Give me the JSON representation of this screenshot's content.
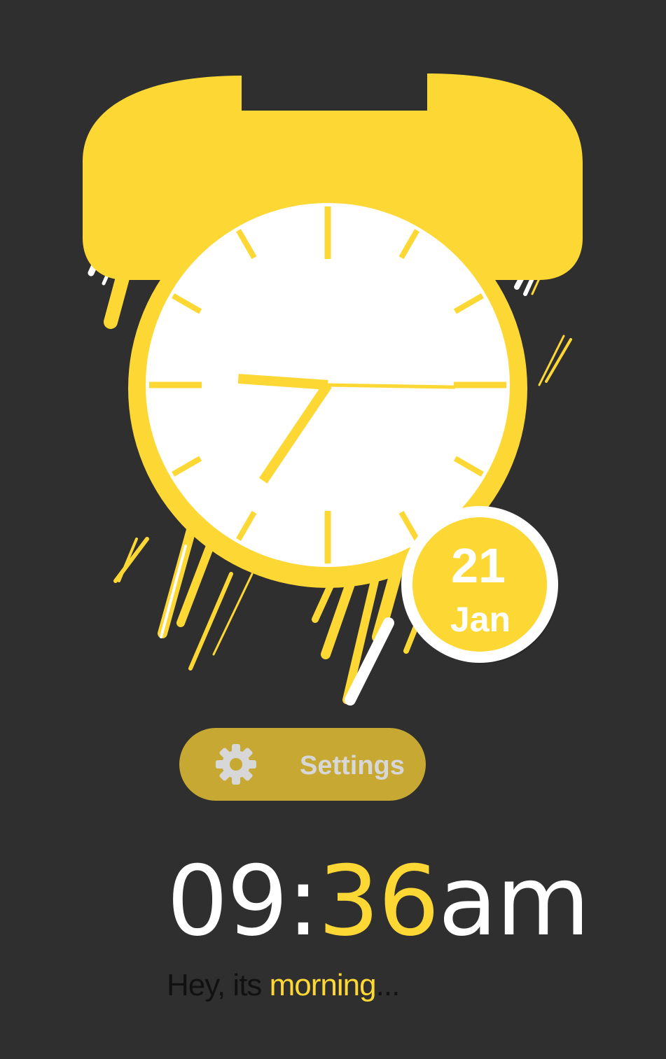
{
  "colors": {
    "background": "#2f2f2f",
    "accent": "#fdd835",
    "clock_face": "#ffffff",
    "button_fill": "#c6a832",
    "button_text": "#d7d7d7",
    "greeting_text": "#111111"
  },
  "clock": {
    "hour_hand_value": 9.6,
    "minute_hand_value": 36,
    "second_hand_value": 15
  },
  "date_badge": {
    "day": "21",
    "month": "Jan"
  },
  "settings": {
    "icon": "gear-icon",
    "label": "Settings"
  },
  "time": {
    "hours": "09",
    "separator": ":",
    "minutes": "36",
    "suffix": "am"
  },
  "greeting": {
    "prefix": "Hey, its ",
    "highlight": "morning",
    "suffix": "..."
  }
}
